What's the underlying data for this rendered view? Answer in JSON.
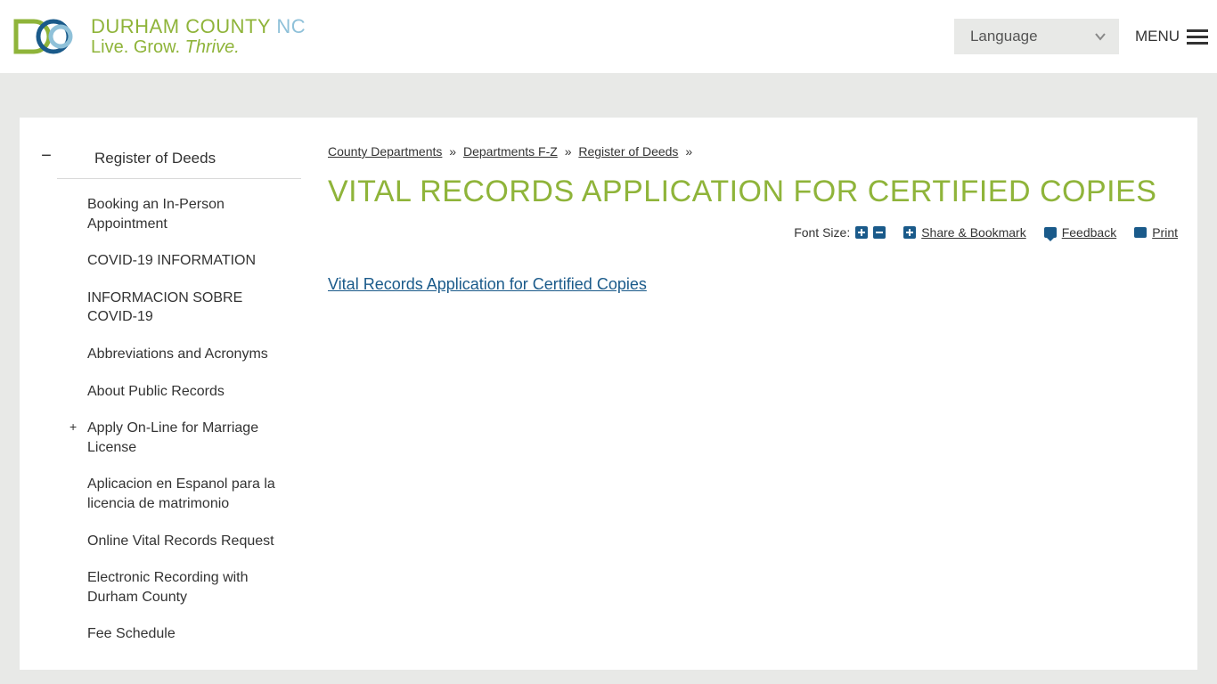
{
  "header": {
    "brand_line1_durham": "DURHAM",
    "brand_line1_county": "COUNTY",
    "brand_line1_nc": "NC",
    "brand_line2_live": "Live.",
    "brand_line2_grow": "Grow.",
    "brand_line2_thrive": "Thrive.",
    "language_label": "Language",
    "menu_label": "MENU"
  },
  "sidebar": {
    "section_toggle": "−",
    "section_title": "Register of Deeds",
    "items": [
      {
        "label": "Booking an In-Person Appointment",
        "expandable": false
      },
      {
        "label": "COVID-19 INFORMATION",
        "expandable": false
      },
      {
        "label": "INFORMACION SOBRE COVID-19",
        "expandable": false
      },
      {
        "label": "Abbreviations and Acronyms",
        "expandable": false
      },
      {
        "label": "About Public Records",
        "expandable": false
      },
      {
        "label": "Apply On-Line for Marriage License",
        "expandable": true
      },
      {
        "label": "Aplicacion en Espanol para la licencia de matrimonio",
        "expandable": false
      },
      {
        "label": "Online Vital Records Request",
        "expandable": false
      },
      {
        "label": "Electronic Recording with Durham County",
        "expandable": false
      },
      {
        "label": "Fee Schedule",
        "expandable": false
      }
    ]
  },
  "breadcrumb": {
    "items": [
      "County Departments",
      "Departments F-Z",
      "Register of Deeds"
    ],
    "separator": "»"
  },
  "page": {
    "title": "VITAL RECORDS APPLICATION FOR CERTIFIED COPIES",
    "font_size_label": "Font Size:",
    "share_label": "Share & Bookmark",
    "feedback_label": "Feedback",
    "print_label": "Print",
    "body_link_text": "Vital Records Application for Certified Copies"
  },
  "colors": {
    "green": "#8fb43a",
    "blue": "#1a5a8a",
    "lightblue": "#8fc1d9",
    "bg": "#e8e9e7"
  }
}
